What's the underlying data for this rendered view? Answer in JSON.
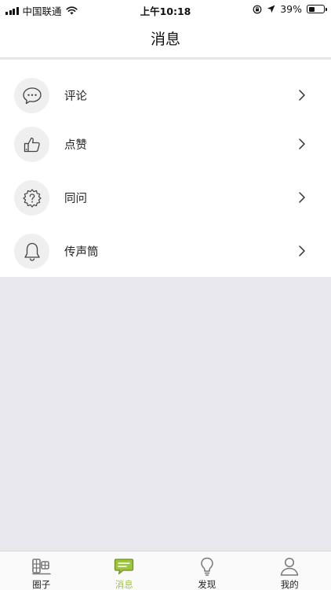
{
  "status_bar": {
    "carrier": "中国联通",
    "time": "上午10:18",
    "battery": "39%",
    "battery_level": 0.39,
    "icons": [
      "signal-icon",
      "wifi-icon",
      "orientation-lock-icon",
      "location-arrow-icon",
      "battery-icon"
    ]
  },
  "nav": {
    "title": "消息"
  },
  "list": {
    "items": [
      {
        "label": "评论",
        "icon": "speech-bubble-icon"
      },
      {
        "label": "点赞",
        "icon": "thumbs-up-icon"
      },
      {
        "label": "同问",
        "icon": "question-badge-icon"
      },
      {
        "label": "传声筒",
        "icon": "bell-icon"
      }
    ]
  },
  "tabs": {
    "active_color": "#9cc43c",
    "items": [
      {
        "label": "圈子",
        "icon": "circle-logo-icon",
        "active": false
      },
      {
        "label": "消息",
        "icon": "message-icon",
        "active": true
      },
      {
        "label": "发现",
        "icon": "lightbulb-icon",
        "active": false
      },
      {
        "label": "我的",
        "icon": "profile-icon",
        "active": false
      }
    ]
  }
}
